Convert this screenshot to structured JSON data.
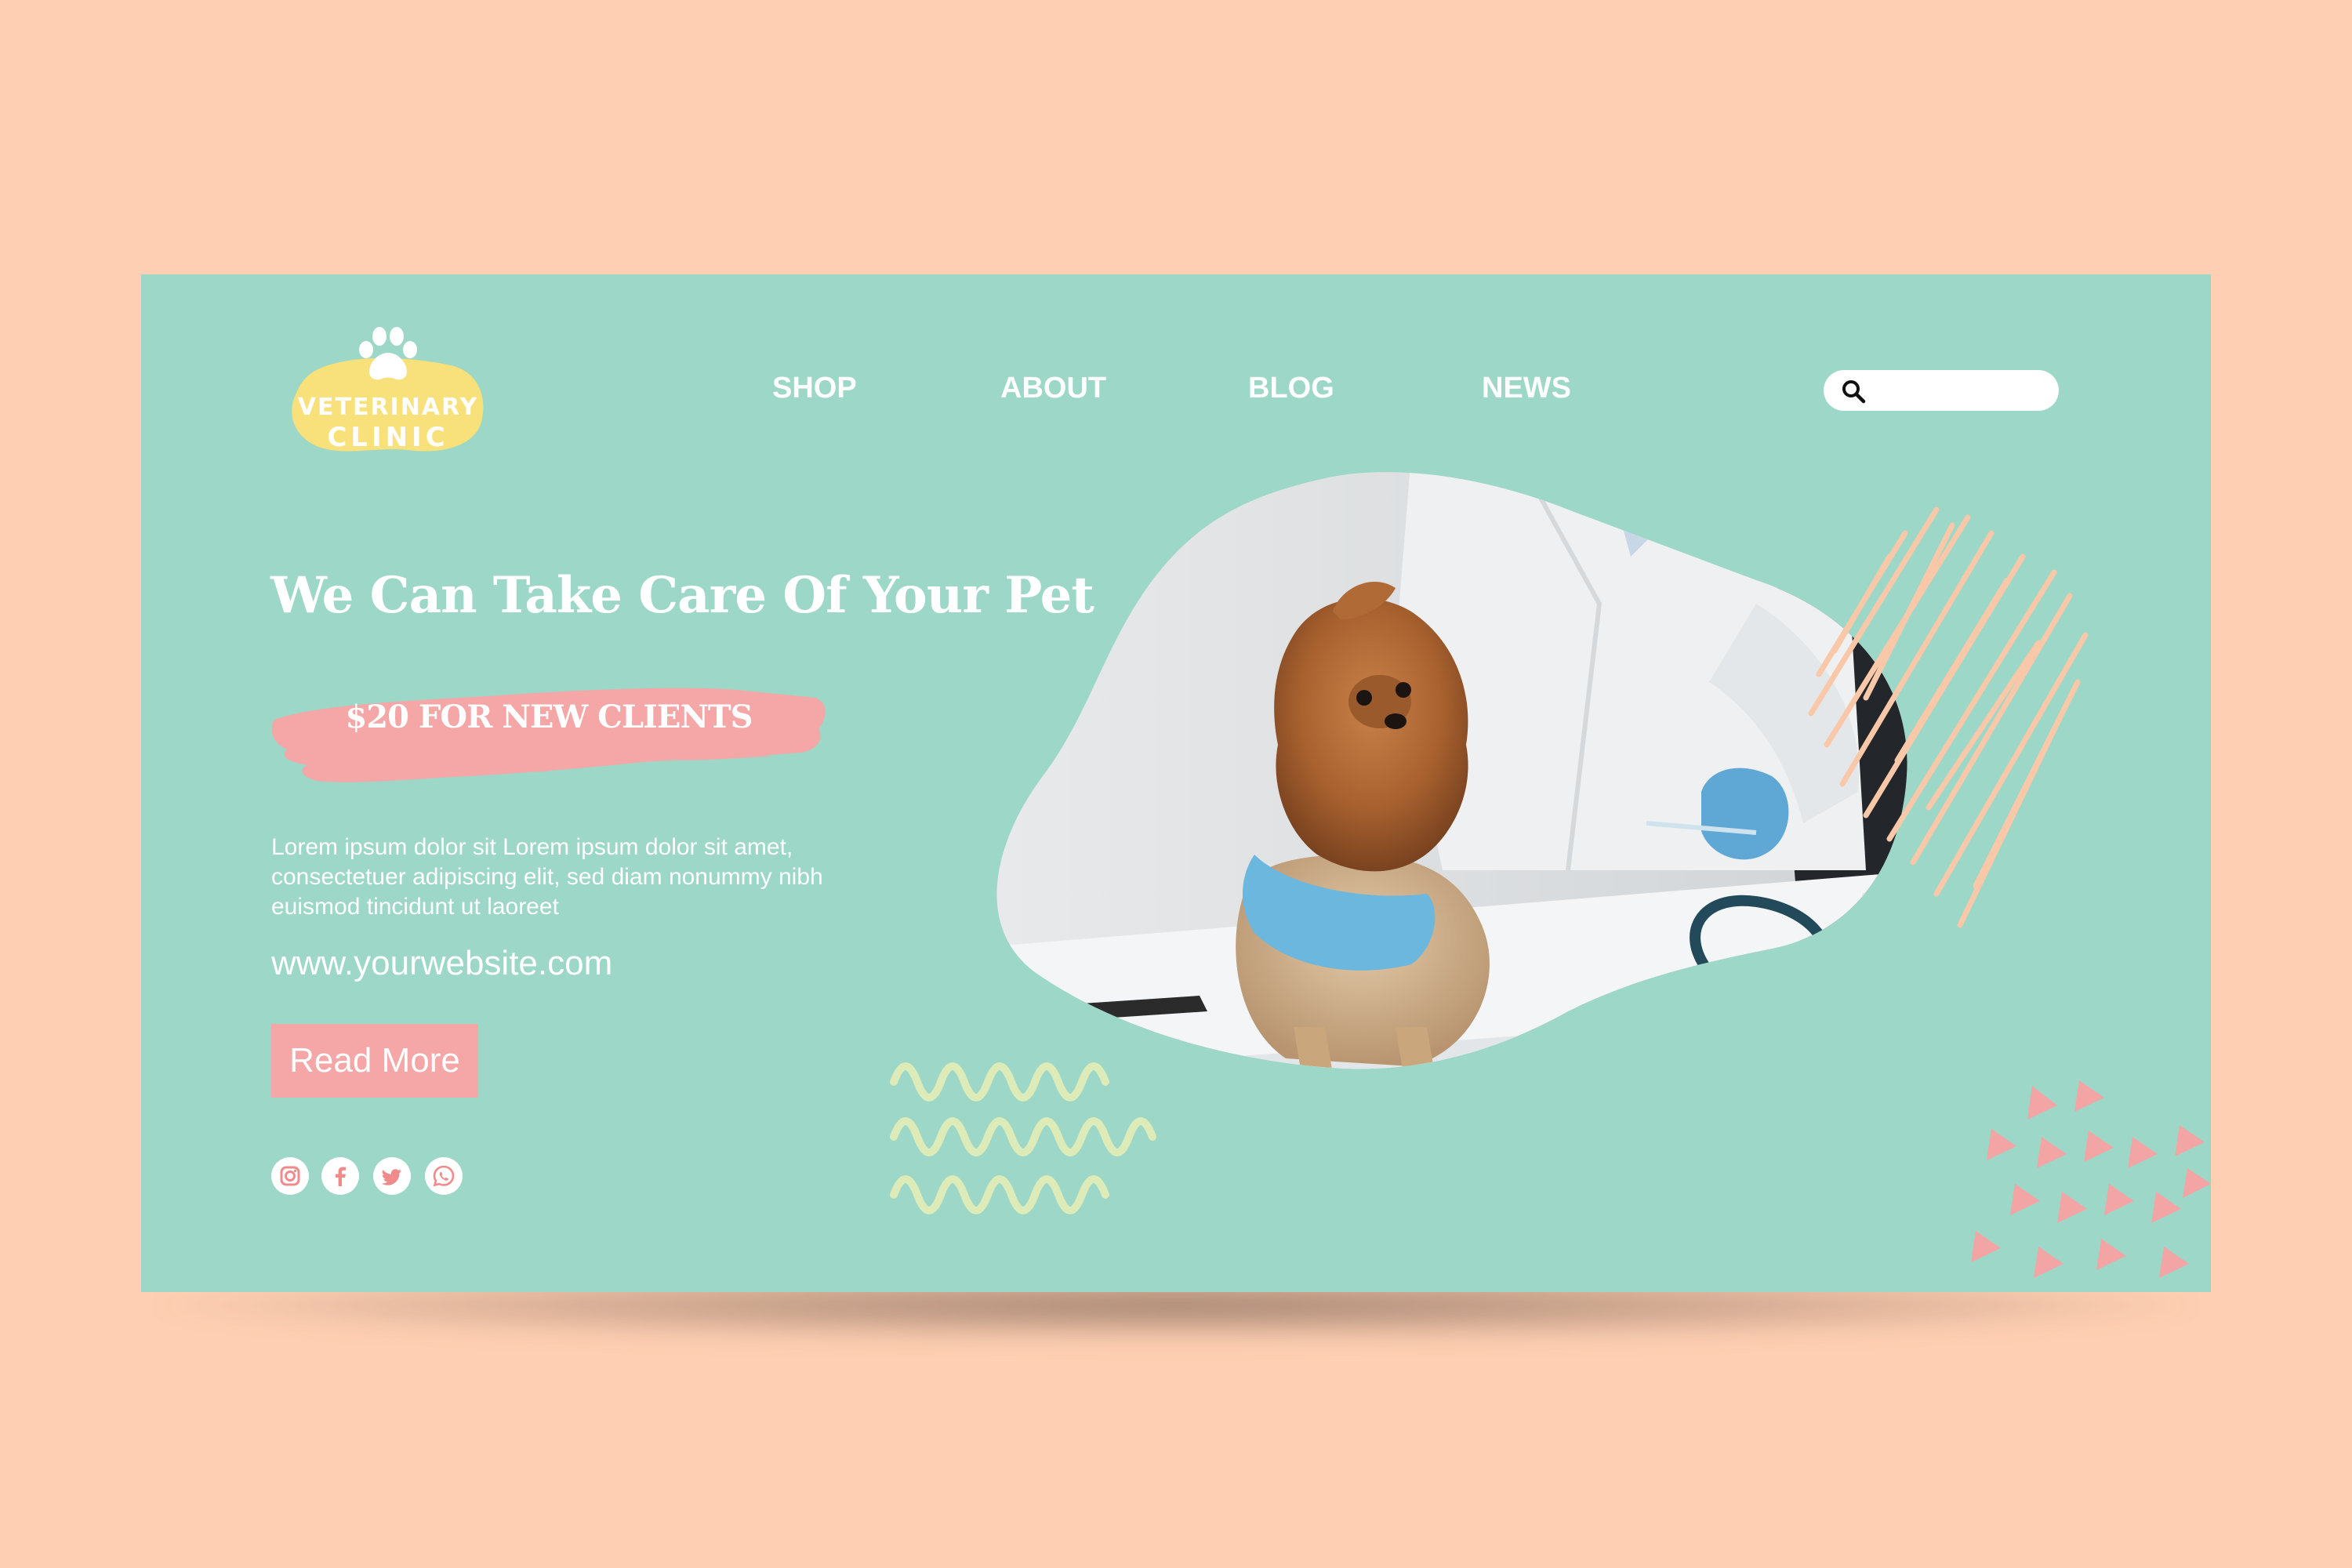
{
  "logo": {
    "line1": "VETERINARY",
    "line2": "CLINIC",
    "icon": "paw-icon",
    "blob_color": "#f8e07a"
  },
  "nav": {
    "items": [
      {
        "label": "SHOP"
      },
      {
        "label": "ABOUT"
      },
      {
        "label": "BLOG"
      },
      {
        "label": "NEWS"
      }
    ]
  },
  "search": {
    "icon": "search-icon",
    "value": "",
    "placeholder": ""
  },
  "hero": {
    "headline": "We Can Take Care Of Your Pet",
    "promo": "$20 FOR NEW CLIENTS",
    "body": "Lorem ipsum dolor sit Lorem ipsum dolor sit amet, consectetuer adipiscing elit, sed diam nonummy nibh euismod tincidunt ut laoreet",
    "website": "www.yourwebsite.com",
    "cta": "Read More"
  },
  "social": [
    {
      "icon": "instagram-icon"
    },
    {
      "icon": "facebook-icon"
    },
    {
      "icon": "twitter-icon"
    },
    {
      "icon": "whatsapp-icon"
    }
  ],
  "colors": {
    "page_background": "#fecfb2",
    "banner_background": "#9dd7c7",
    "accent_pink": "#f5a6a6",
    "text": "#ffffff",
    "zigzag": "#dcebb7",
    "scribble": "#f9c8a8",
    "triangles": "#f3a5a5"
  }
}
